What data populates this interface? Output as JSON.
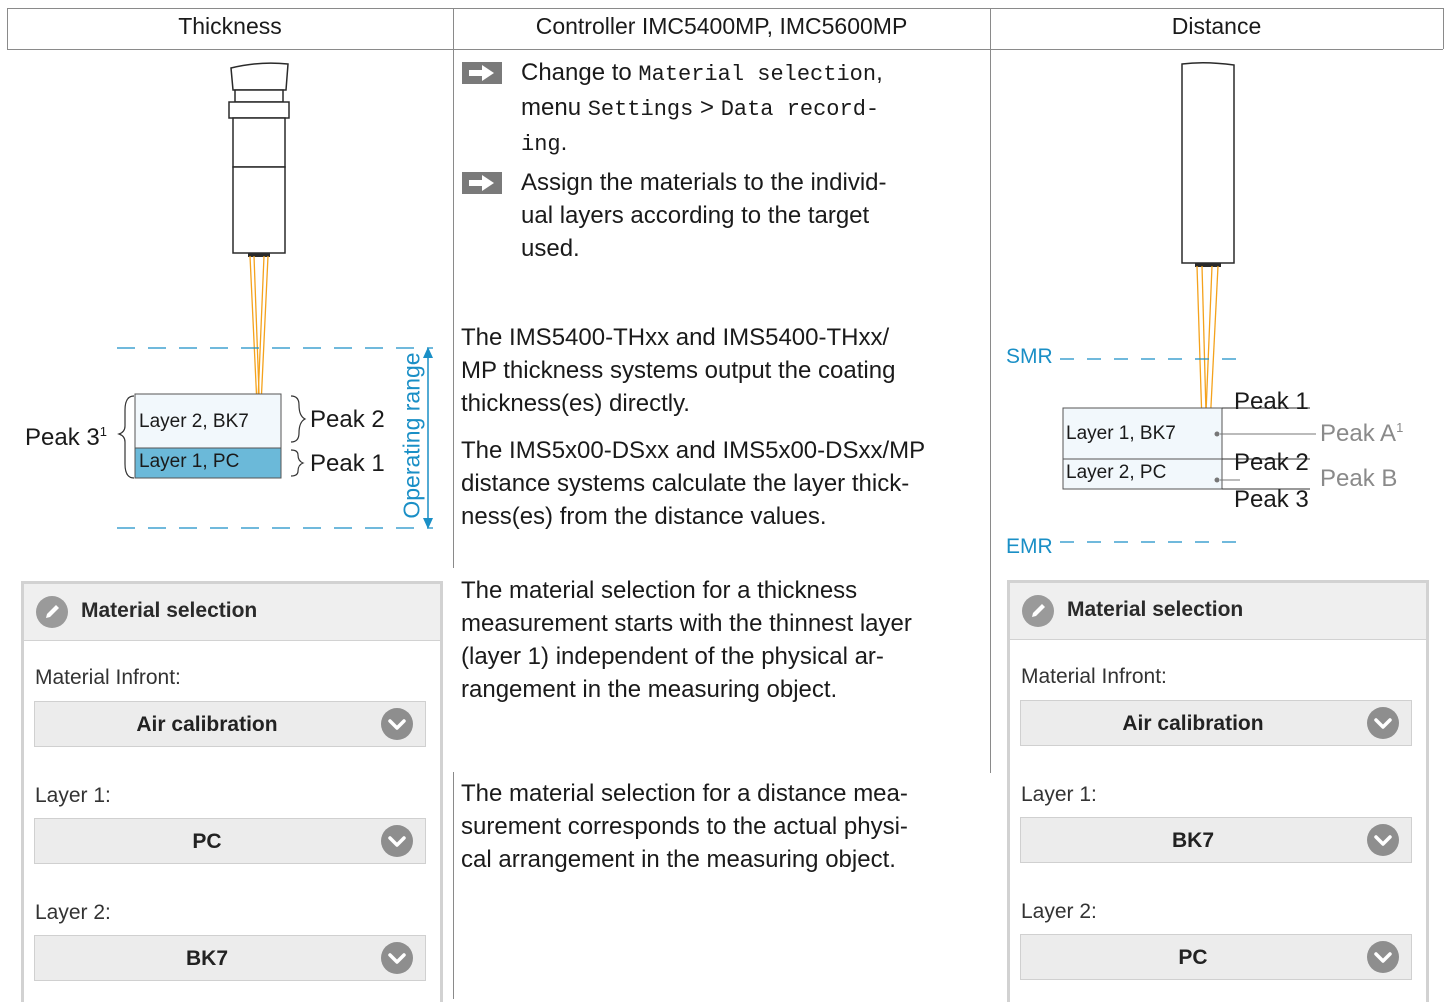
{
  "headers": {
    "thickness": "Thickness",
    "controller": "Controller IMC5400MP, IMC5600MP",
    "distance": "Distance"
  },
  "steps": [
    {
      "prefix": "Change to ",
      "mono1": "Material selection",
      "mid1": ",",
      "line2_prefix": "menu ",
      "mono2": "Settings",
      "gt": " > ",
      "mono3": "Data record-",
      "mono4": "ing",
      "end": "."
    },
    {
      "line1": "Assign the materials to the individ-",
      "line2": "ual layers according to the target",
      "line3": "used."
    }
  ],
  "paragraphs": {
    "p1_l1": "The IMS5400-THxx and IMS5400-THxx/",
    "p1_l2": "MP thickness systems output the coating",
    "p1_l3": "thickness(es) directly.",
    "p2_l1": "The IMS5x00-DSxx and IMS5x00-DSxx/MP",
    "p2_l2": "distance systems calculate the layer thick-",
    "p2_l3": "ness(es) from the distance values.",
    "p3_l1": "The material selection for a thickness",
    "p3_l2": "measurement starts with the thinnest layer",
    "p3_l3": "(layer 1) independent of the physical ar-",
    "p3_l4": "rangement in the measuring object.",
    "p4_l1": "The material selection for a distance mea-",
    "p4_l2": "surement corresponds to the actual physi-",
    "p4_l3": "cal arrangement in the measuring object."
  },
  "thickness_diagram": {
    "peak3": "Peak 3",
    "sup": "1",
    "peak2": "Peak 2",
    "peak1": "Peak 1",
    "layer2": "Layer 2, BK7",
    "layer1": "Layer 1, PC",
    "operating_range": "Operating range",
    "layer1_color": "#6bb9d9"
  },
  "distance_diagram": {
    "smr": "SMR",
    "emr": "EMR",
    "peak1": "Peak 1",
    "peak2": "Peak 2",
    "peak3": "Peak 3",
    "peakA": "Peak A",
    "peakA_sup": "1",
    "peakB": "Peak B",
    "layer1": "Layer 1, BK7",
    "layer2": "Layer 2, PC",
    "accent": "#1a8fc6"
  },
  "left_panel": {
    "title": "Material selection",
    "material_infront_label": "Material Infront:",
    "material_infront_value": "Air calibration",
    "layer1_label": "Layer 1:",
    "layer1_value": "PC",
    "layer2_label": "Layer 2:",
    "layer2_value": "BK7"
  },
  "right_panel": {
    "title": "Material selection",
    "material_infront_label": "Material Infront:",
    "material_infront_value": "Air calibration",
    "layer1_label": "Layer 1:",
    "layer1_value": "BK7",
    "layer2_label": "Layer 2:",
    "layer2_value": "PC"
  }
}
